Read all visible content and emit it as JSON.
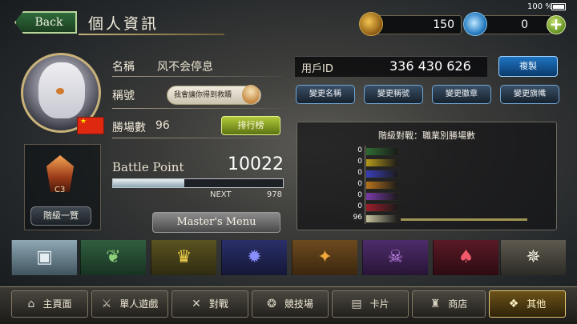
{
  "status": {
    "battery": "100 %"
  },
  "header": {
    "back_label": "Back",
    "page_title": "個人資訊",
    "gold": "150",
    "gems": "0",
    "add_label": "+"
  },
  "profile": {
    "name_label": "名稱",
    "name": "风不会停息",
    "title_label": "稱號",
    "title_badge": "我會讓你得到救贖",
    "wins_label": "勝場數",
    "wins": "96",
    "country_flag": "China",
    "leaderboard_label": "排行榜",
    "rank_code": "C3",
    "rank_list_label": "階級一覽"
  },
  "battle_point": {
    "label": "Battle Point",
    "value": "10022",
    "next_label": "NEXT",
    "next_value": "978",
    "progress_fraction": 0.42,
    "masters_menu_label": "Master's Menu"
  },
  "account": {
    "userid_label": "用戶ID",
    "userid": "336 430 626",
    "copy_label": "複製",
    "change_name": "變更名稱",
    "change_title": "變更稱號",
    "change_badge": "變更徽章",
    "change_banner": "變更旗幟"
  },
  "class_wins": {
    "title": "階級對戰：職業別勝場數",
    "rows": [
      {
        "class": "forestcraft",
        "wins": "0",
        "color": "#2f6b34"
      },
      {
        "class": "swordcraft",
        "wins": "0",
        "color": "#b59a1c"
      },
      {
        "class": "runecraft",
        "wins": "0",
        "color": "#3a3fb8"
      },
      {
        "class": "dragoncraft",
        "wins": "0",
        "color": "#b8731c"
      },
      {
        "class": "shadowcraft",
        "wins": "0",
        "color": "#7a3aa8"
      },
      {
        "class": "bloodcraft",
        "wins": "0",
        "color": "#9c1e2b"
      },
      {
        "class": "havencraft",
        "wins": "96",
        "color": "#c8c2a0"
      }
    ]
  },
  "class_tabs": [
    {
      "name": "deck",
      "glyph": "▣"
    },
    {
      "name": "forest",
      "glyph": "❦"
    },
    {
      "name": "sword",
      "glyph": "♛"
    },
    {
      "name": "rune",
      "glyph": "✹"
    },
    {
      "name": "dragon",
      "glyph": "✦"
    },
    {
      "name": "shadow",
      "glyph": "☠"
    },
    {
      "name": "blood",
      "glyph": "♠"
    },
    {
      "name": "haven",
      "glyph": "✵"
    }
  ],
  "bottom_nav": {
    "home": "主頁面",
    "solo": "單人遊戲",
    "battle": "對戰",
    "arena": "競技場",
    "cards": "卡片",
    "shop": "商店",
    "other": "其他"
  },
  "colors": {
    "accent_green": "#5b7312",
    "accent_blue": "#1f74c2",
    "gold": "#c9b27a"
  }
}
